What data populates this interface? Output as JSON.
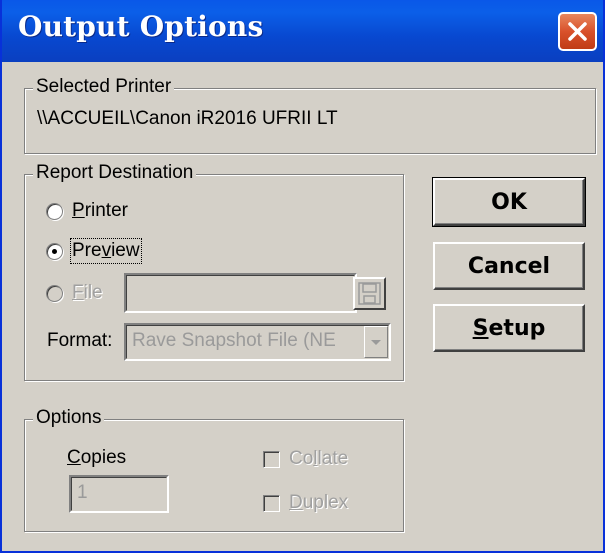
{
  "window": {
    "title": "Output Options"
  },
  "selected_printer": {
    "group_label": "Selected Printer",
    "printer_name": "\\\\ACCUEIL\\Canon iR2016 UFRII LT"
  },
  "report_destination": {
    "group_label": "Report Destination",
    "options": [
      {
        "label_pre": "",
        "label_u": "P",
        "label_post": "rinter",
        "checked": false,
        "enabled": true
      },
      {
        "label_pre": "Pre",
        "label_u": "v",
        "label_post": "iew",
        "checked": true,
        "enabled": true
      },
      {
        "label_pre": "",
        "label_u": "F",
        "label_post": "ile",
        "checked": false,
        "enabled": false
      }
    ],
    "file_path_value": "",
    "format_label": "Format:",
    "format_value": "Rave Snapshot File (NE"
  },
  "options": {
    "group_label": "Options",
    "copies_label_u": "C",
    "copies_label_post": "opies",
    "copies_value": "1",
    "collate_pre": "Co",
    "collate_u": "l",
    "collate_post": "late",
    "collate_checked": false,
    "duplex_pre": "",
    "duplex_u": "D",
    "duplex_post": "uplex",
    "duplex_checked": false
  },
  "buttons": {
    "ok_label": "OK",
    "cancel_label": "Cancel",
    "setup_u": "S",
    "setup_post": "etup"
  },
  "colors": {
    "titlebar": "#0a58e8",
    "face": "#d4d0c8",
    "close": "#d9512b"
  },
  "icons": [
    "close-icon",
    "save-disk-icon",
    "dropdown-arrow-icon"
  ]
}
